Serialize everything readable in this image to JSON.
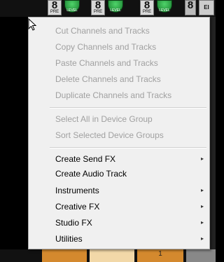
{
  "channels": [
    {
      "number": "8",
      "label": "PRE",
      "knob_label": "LEVEL"
    },
    {
      "number": "8",
      "label": "PRE",
      "knob_label": "LEVEL"
    },
    {
      "number": "8",
      "label": "PRE",
      "knob_label": "LEVEL"
    }
  ],
  "extra_channel": {
    "number": "8",
    "label": "EI"
  },
  "bottom_tile_label": "1",
  "menu": {
    "group1": [
      {
        "label": "Cut Channels and Tracks",
        "enabled": false
      },
      {
        "label": "Copy Channels and Tracks",
        "enabled": false
      },
      {
        "label": "Paste Channels and Tracks",
        "enabled": false
      },
      {
        "label": "Delete Channels and Tracks",
        "enabled": false
      },
      {
        "label": "Duplicate Channels and Tracks",
        "enabled": false
      }
    ],
    "group2": [
      {
        "label": "Select All in Device Group",
        "enabled": false
      },
      {
        "label": "Sort Selected Device Groups",
        "enabled": false
      }
    ],
    "group3": [
      {
        "label": "Create Send FX",
        "enabled": true,
        "submenu": true
      },
      {
        "label": "Create Audio Track",
        "enabled": true,
        "submenu": false
      },
      {
        "label": "Instruments",
        "enabled": true,
        "submenu": true
      },
      {
        "label": "Creative FX",
        "enabled": true,
        "submenu": true
      },
      {
        "label": "Studio FX",
        "enabled": true,
        "submenu": true
      },
      {
        "label": "Utilities",
        "enabled": true,
        "submenu": true
      }
    ],
    "submenu_arrow": "▸"
  },
  "colors": {
    "menu_bg": "#f0f0f0",
    "disabled_text": "#a0a0a0",
    "knob": "#2eaa48",
    "tile_orange": "#d4892e",
    "tile_light": "#f2d8a8"
  }
}
